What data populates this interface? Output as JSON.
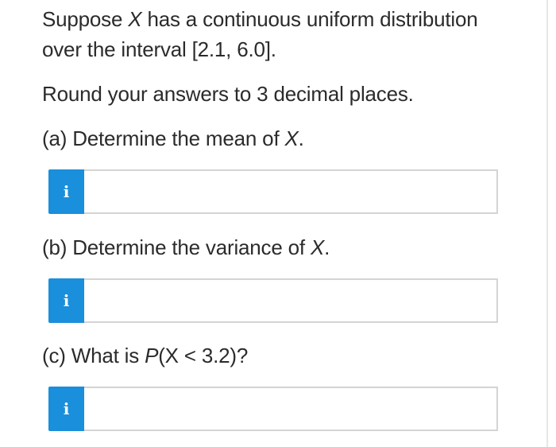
{
  "problem": {
    "intro_line1_a": "Suppose ",
    "intro_var": "X",
    "intro_line1_b": " has a continuous uniform distribution",
    "intro_line2": "over the interval [2.1, 6.0].",
    "rounding": "Round your answers to 3 decimal places."
  },
  "questions": [
    {
      "prefix": "(a) Determine the mean of ",
      "var": "X",
      "suffix": ".",
      "info_label": "i",
      "answer": ""
    },
    {
      "prefix": "(b) Determine the variance of ",
      "var": "X",
      "suffix": ".",
      "info_label": "i",
      "answer": ""
    },
    {
      "prefix": "(c) What is ",
      "var": "P",
      "suffix": "(X < 3.2)?",
      "info_label": "i",
      "answer": ""
    }
  ],
  "colors": {
    "info_button": "#1a8fdb",
    "input_border": "#d4d4d4",
    "text": "#2b2b2b"
  },
  "icons": {
    "info": "info-icon"
  }
}
